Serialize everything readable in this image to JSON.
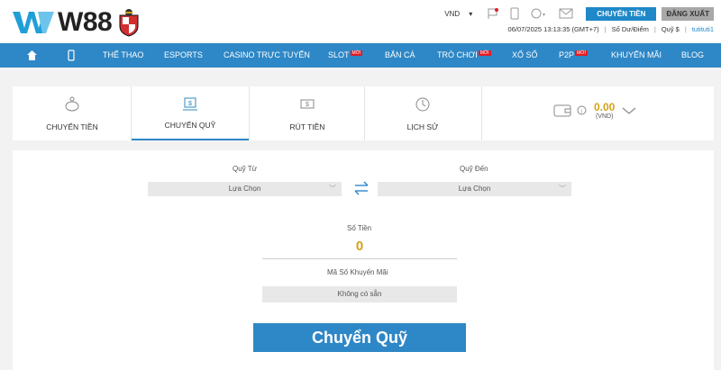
{
  "header": {
    "logo_text": "W88",
    "currency": "VND",
    "transfer_button": "CHUYỂN TIỀN",
    "logout_button": "ĐĂNG XUẤT",
    "datetime": "06/07/2025 13:13:35 (GMT+7)",
    "balance_label": "Số Dư/Điểm",
    "fund_label": "Quỹ $",
    "username": "tutituti1"
  },
  "nav": {
    "items": [
      "THỂ THAO",
      "ESPORTS",
      "CASINO TRỰC TUYẾN",
      "SLOT",
      "BẮN CÁ",
      "TRÒ CHƠI",
      "XỔ SỐ",
      "P2P",
      "KHUYẾN MÃI",
      "BLOG"
    ],
    "badge": "MỚI"
  },
  "tabs": [
    "CHUYỂN TIỀN",
    "CHUYỂN QUỸ",
    "RÚT TIỀN",
    "LỊCH SỬ"
  ],
  "balance": {
    "amount": "0.00",
    "currency": "(VND)"
  },
  "form": {
    "from_label": "Quỹ Từ",
    "from_value": "Lựa Chọn",
    "to_label": "Quỹ Đến",
    "to_value": "Lựa Chọn",
    "amount_label": "Số Tiền",
    "amount_value": "0",
    "promo_label": "Mã Số Khuyến Mãi",
    "promo_value": "Không có sẵn",
    "submit": "Chuyển Quỹ"
  },
  "colors": {
    "accent": "#2e87c6",
    "gold": "#d4a017",
    "red_badge": "#e31b23"
  }
}
